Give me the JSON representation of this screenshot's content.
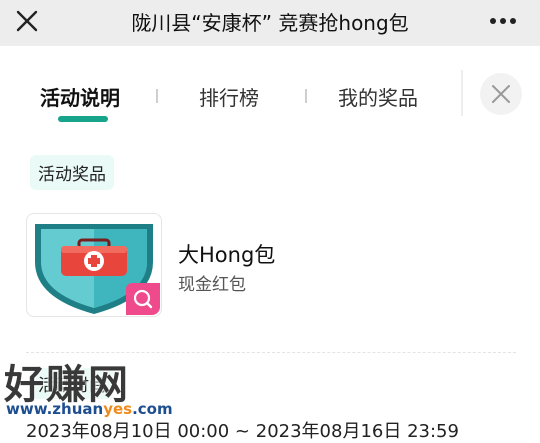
{
  "header": {
    "title": "陇川县“安康杯” 竞赛抢hong包"
  },
  "tabs": [
    {
      "label": "活动说明",
      "active": true
    },
    {
      "label": "排行榜",
      "active": false
    },
    {
      "label": "我的奖品",
      "active": false
    }
  ],
  "prizes_section": {
    "title": "活动奖品",
    "prize": {
      "name": "大Hong包",
      "type": "现金红包"
    }
  },
  "time_section": {
    "title": "活动时间",
    "range": "2023年08月10日 00:00 ~ 2023年08月16日 23:59"
  },
  "watermark": {
    "main": "好赚网",
    "site_pre": "www.zhuan",
    "site_hl": "yes",
    "site_post": ".com"
  },
  "colors": {
    "accent": "#16a48a",
    "zoom_button": "#ef4a8c",
    "label_bg": "#eafaf6"
  }
}
